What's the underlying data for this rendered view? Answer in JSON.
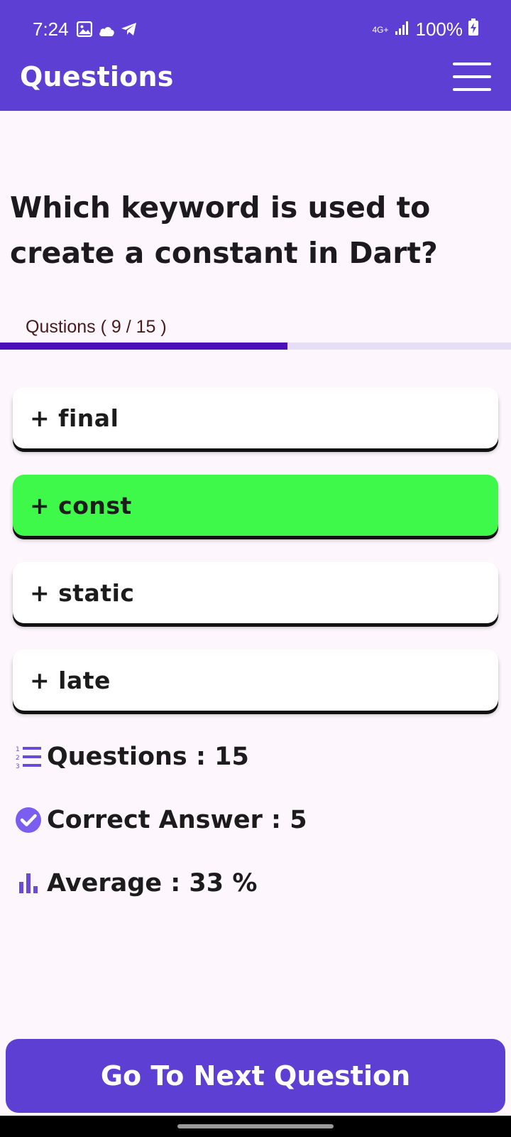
{
  "status_bar": {
    "time": "7:24",
    "network": "4G+",
    "battery": "100%"
  },
  "header": {
    "title": "Questions"
  },
  "question": {
    "text": "Which keyword is used to create a constant in Dart?",
    "progress_label": "Qustions ( 9 / 15 )",
    "progress_fraction": 0.5625
  },
  "options": [
    {
      "label": "+ final",
      "selected": false
    },
    {
      "label": "+ const",
      "selected": true
    },
    {
      "label": "+ static",
      "selected": false
    },
    {
      "label": "+ late",
      "selected": false
    }
  ],
  "stats": {
    "questions": "Questions : 15",
    "correct": "Correct Answer : 5",
    "average": "Average : 33 %"
  },
  "next_button": {
    "label": "Go To Next Question"
  },
  "colors": {
    "primary": "#5d40d3",
    "correct": "#3ff94a",
    "progress": "#4a0fb8",
    "background": "#fdf6fd"
  }
}
